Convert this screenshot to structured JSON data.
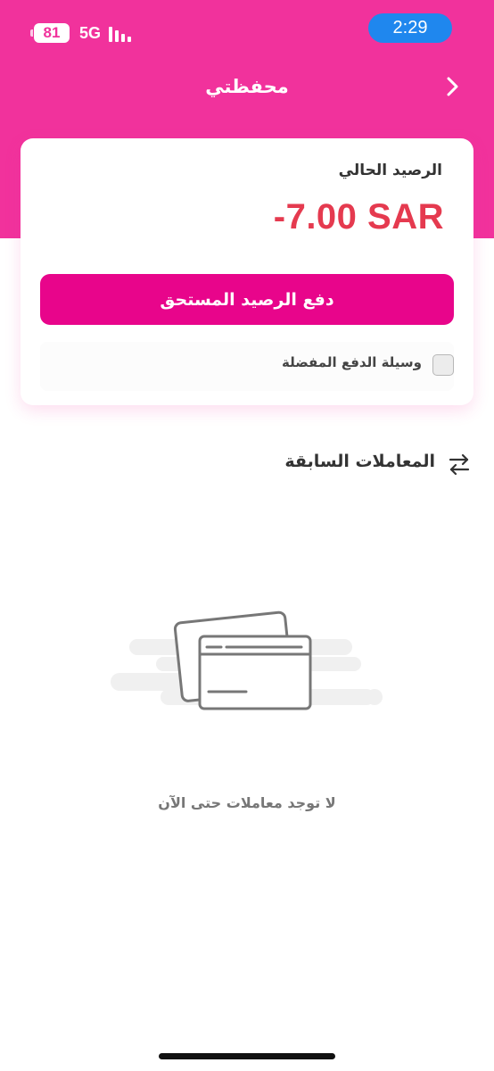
{
  "status_bar": {
    "battery": "81",
    "network": "5G",
    "time": "2:29"
  },
  "nav": {
    "title": "محفظتي",
    "back_icon": "chevron-right-icon"
  },
  "wallet": {
    "balance_label": "الرصيد الحالي",
    "balance_amount": "-7.00 SAR",
    "pay_button_label": "دفع الرصيد المستحق",
    "preferred_payment_label": "وسيلة الدفع المفضلة",
    "preferred_payment_checked": false
  },
  "transactions": {
    "icon": "swap-arrows-icon",
    "title": "المعاملات السابقة",
    "empty_message": "لا توجد معاملات حتى الآن",
    "empty_illustration": "credit-cards-icon"
  },
  "colors": {
    "brand_pink": "#f1329c",
    "button_pink": "#e8058b",
    "negative_balance": "#e53a4f",
    "time_pill": "#1f87ee"
  }
}
